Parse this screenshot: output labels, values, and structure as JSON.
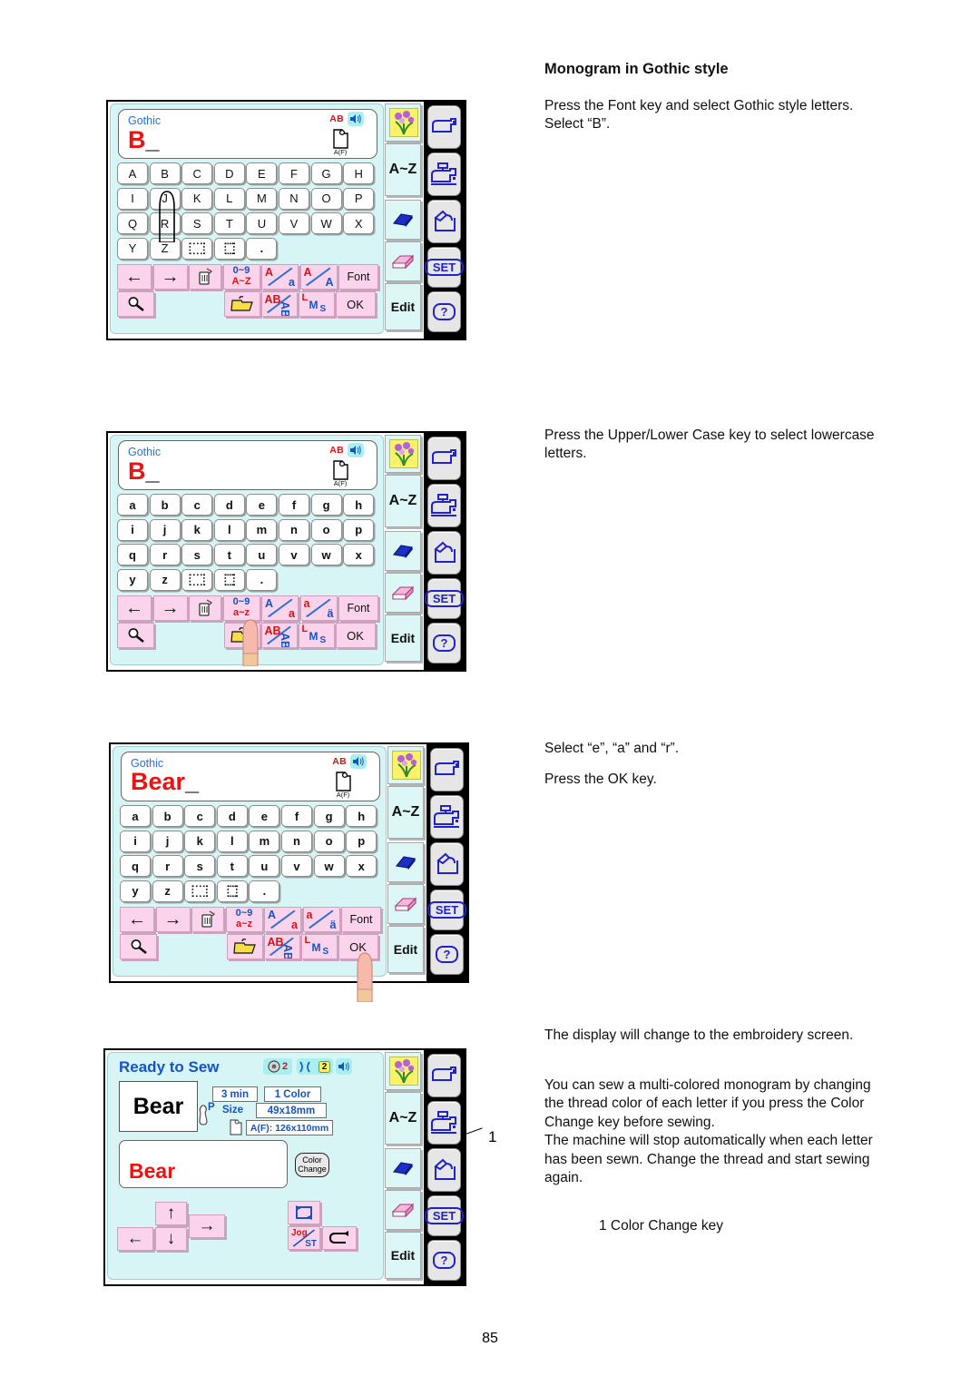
{
  "page": {
    "number": "85"
  },
  "article": {
    "heading": "Monogram in Gothic style",
    "steps": [
      {
        "id": "step1",
        "lines": [
          "Press the Font key and select Gothic style letters.",
          "Select “B”."
        ]
      },
      {
        "id": "step2",
        "lines": [
          "Press the Upper/Lower Case key to select lowercase",
          "letters."
        ]
      },
      {
        "id": "step3",
        "lines": [
          "Select “e”, “a” and “r”."
        ],
        "lines2": [
          "Press the OK key."
        ]
      },
      {
        "id": "step4",
        "lines": [
          "The display will change to the embroidery screen."
        ],
        "lines2": [
          "You can sew a multi-colored monogram by changing",
          "the thread color of each letter if you press the Color",
          "Change key before sewing.",
          "The machine will stop automatically when each letter",
          "has been sewn. Change the thread and start sewing",
          "again."
        ],
        "callout": "1",
        "legend": "1 Color Change key"
      }
    ]
  },
  "screens": {
    "keyboard_upper": {
      "font_name": "Gothic",
      "typed_text": "B",
      "cursor": "_",
      "case_indicator": "AB",
      "hoop_label": "A(F)",
      "rows": [
        [
          "A",
          "B",
          "C",
          "D",
          "E",
          "F",
          "G",
          "H"
        ],
        [
          "I",
          "J",
          "K",
          "L",
          "M",
          "N",
          "O",
          "P"
        ],
        [
          "Q",
          "R",
          "S",
          "T",
          "U",
          "V",
          "W",
          "X"
        ],
        [
          "Y",
          "Z",
          "░",
          "▒",
          "."
        ]
      ],
      "function_keys": [
        {
          "name": "cursor-left",
          "label": "←"
        },
        {
          "name": "cursor-right",
          "label": "→"
        },
        {
          "name": "delete",
          "label": "trash-icon"
        },
        {
          "name": "number-letter-toggle",
          "top": "0~9",
          "bottom": "A~Z"
        },
        {
          "name": "upper-lower-case-toggle",
          "top": "A",
          "bottom": "a"
        },
        {
          "name": "letter-size-toggle",
          "top": "A",
          "bottom": "A"
        },
        {
          "name": "font",
          "label": "Font"
        },
        {
          "name": "zoom",
          "label": "magnifier-icon"
        },
        {
          "name": "open-file",
          "label": "folder-icon"
        },
        {
          "name": "orientation-toggle",
          "top": "AB",
          "bottom": "AB"
        },
        {
          "name": "size-toggle",
          "top": "L",
          "mid": "M",
          "bottom": "S"
        },
        {
          "name": "ok",
          "label": "OK"
        }
      ],
      "side_keys": [
        {
          "name": "pattern-preview",
          "label": "flower-icon"
        },
        {
          "name": "monogram-mode",
          "label": "A~Z"
        },
        {
          "name": "erase-all",
          "label": "eraser-blue-icon"
        },
        {
          "name": "erase-one",
          "label": "eraser-pink-icon"
        },
        {
          "name": "edit",
          "label": "Edit"
        }
      ],
      "hard_keys": [
        {
          "name": "sewing-mode",
          "label": "sewing-machine-icon"
        },
        {
          "name": "embroidery-mode",
          "label": "embroidery-machine-icon"
        },
        {
          "name": "file-mode",
          "label": "open-pocket-icon"
        },
        {
          "name": "set",
          "label": "SET"
        },
        {
          "name": "help",
          "label": "?"
        }
      ],
      "pointing_at": "B"
    },
    "keyboard_lower": {
      "font_name": "Gothic",
      "typed_text": "B",
      "cursor": "_",
      "case_indicator": "AB",
      "hoop_label": "A(F)",
      "rows": [
        [
          "a",
          "b",
          "c",
          "d",
          "e",
          "f",
          "g",
          "h"
        ],
        [
          "i",
          "j",
          "k",
          "l",
          "m",
          "n",
          "o",
          "p"
        ],
        [
          "q",
          "r",
          "s",
          "t",
          "u",
          "v",
          "w",
          "x"
        ],
        [
          "y",
          "z",
          "░",
          "▒",
          "."
        ]
      ],
      "function_keys": [
        {
          "name": "cursor-left",
          "label": "←"
        },
        {
          "name": "cursor-right",
          "label": "→"
        },
        {
          "name": "delete",
          "label": "trash-icon"
        },
        {
          "name": "number-letter-toggle",
          "top": "0~9",
          "bottom": "a~z"
        },
        {
          "name": "upper-lower-case-toggle",
          "top": "A",
          "bottom": "a"
        },
        {
          "name": "accent-toggle",
          "top": "a",
          "bottom": "ä"
        },
        {
          "name": "font",
          "label": "Font"
        },
        {
          "name": "zoom",
          "label": "magnifier-icon"
        },
        {
          "name": "open-file",
          "label": "folder-icon"
        },
        {
          "name": "orientation-toggle",
          "top": "AB",
          "bottom": "AB"
        },
        {
          "name": "size-toggle",
          "top": "L",
          "mid": "M",
          "bottom": "S"
        },
        {
          "name": "ok",
          "label": "OK"
        }
      ],
      "pointing_at": "upper-lower-case-toggle"
    },
    "keyboard_bear": {
      "font_name": "Gothic",
      "typed_text": "Bear",
      "cursor": "_",
      "case_indicator": "AB",
      "hoop_label": "A(F)",
      "pointing_at": "ok"
    },
    "ready_to_sew": {
      "title": "Ready to Sew",
      "preview_text": "Bear",
      "stitch_text": "Bear",
      "status_icons": [
        {
          "name": "bobbin-indicator",
          "value": "2"
        },
        {
          "name": "needle-thread-indicator",
          "value": "2"
        },
        {
          "name": "sound-indicator",
          "value": ""
        }
      ],
      "time": "3 min",
      "colors": "1 Color",
      "presser_foot": "P",
      "size_label": "Size",
      "size_value": "49x18mm",
      "hoop_value": "A(F): 126x110mm",
      "color_change_button": {
        "line1": "Color",
        "line2": "Change"
      },
      "nav_keys": [
        {
          "name": "move-left",
          "label": "←"
        },
        {
          "name": "move-up",
          "label": "↑"
        },
        {
          "name": "move-down",
          "label": "↓"
        },
        {
          "name": "move-right",
          "label": "→"
        },
        {
          "name": "trace",
          "label": "trace-icon"
        },
        {
          "name": "jog-stitch-toggle",
          "top": "Jog",
          "bottom": "ST"
        },
        {
          "name": "return",
          "label": "return-arrow-icon"
        }
      ]
    }
  },
  "colors": {
    "lcd_background": "#d8f5f5",
    "accent_blue": "#1553c8",
    "accent_red": "#ee1111",
    "pink_key": "#fbd3ea",
    "side_key": "#ddf6f6",
    "hard_key": "#e6e6e6",
    "flower_tile": "#fbf26a",
    "cyan_pill": "#a8f0f0"
  }
}
